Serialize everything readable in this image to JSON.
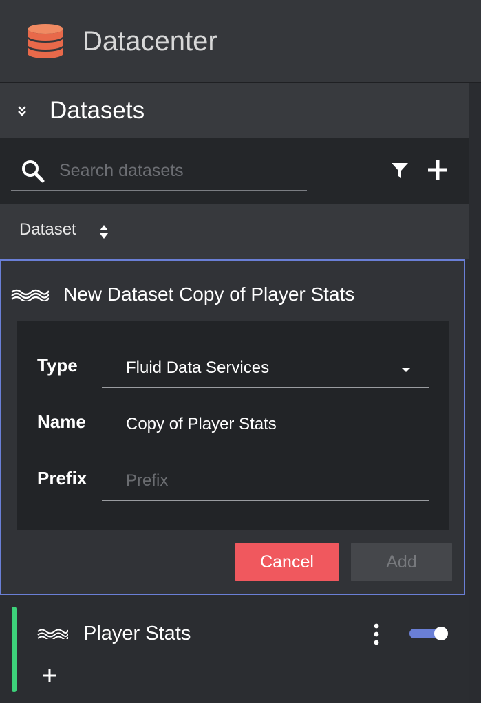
{
  "app": {
    "title": "Datacenter"
  },
  "panel": {
    "title": "Datasets"
  },
  "search": {
    "placeholder": "Search datasets",
    "value": ""
  },
  "table": {
    "column_label": "Dataset"
  },
  "new_dataset": {
    "title": "New Dataset Copy of Player Stats",
    "type_label": "Type",
    "type_value": "Fluid Data Services",
    "name_label": "Name",
    "name_value": "Copy of Player Stats",
    "prefix_label": "Prefix",
    "prefix_placeholder": "Prefix",
    "prefix_value": "",
    "cancel_label": "Cancel",
    "add_label": "Add"
  },
  "datasets": [
    {
      "title": "Player Stats",
      "enabled": true,
      "status_color": "#3dd17a"
    }
  ],
  "icons": {
    "logo": "database-icon",
    "collapse": "chevron-double-down-icon",
    "search": "search-icon",
    "filter": "filter-icon",
    "add": "plus-icon",
    "sort": "sort-icon",
    "dataset": "wave-icon",
    "menu": "kebab-menu-icon"
  },
  "colors": {
    "accent": "#6a7fd6",
    "cancel": "#f0585e",
    "status_ok": "#3dd17a",
    "logo": "#e8694a"
  }
}
